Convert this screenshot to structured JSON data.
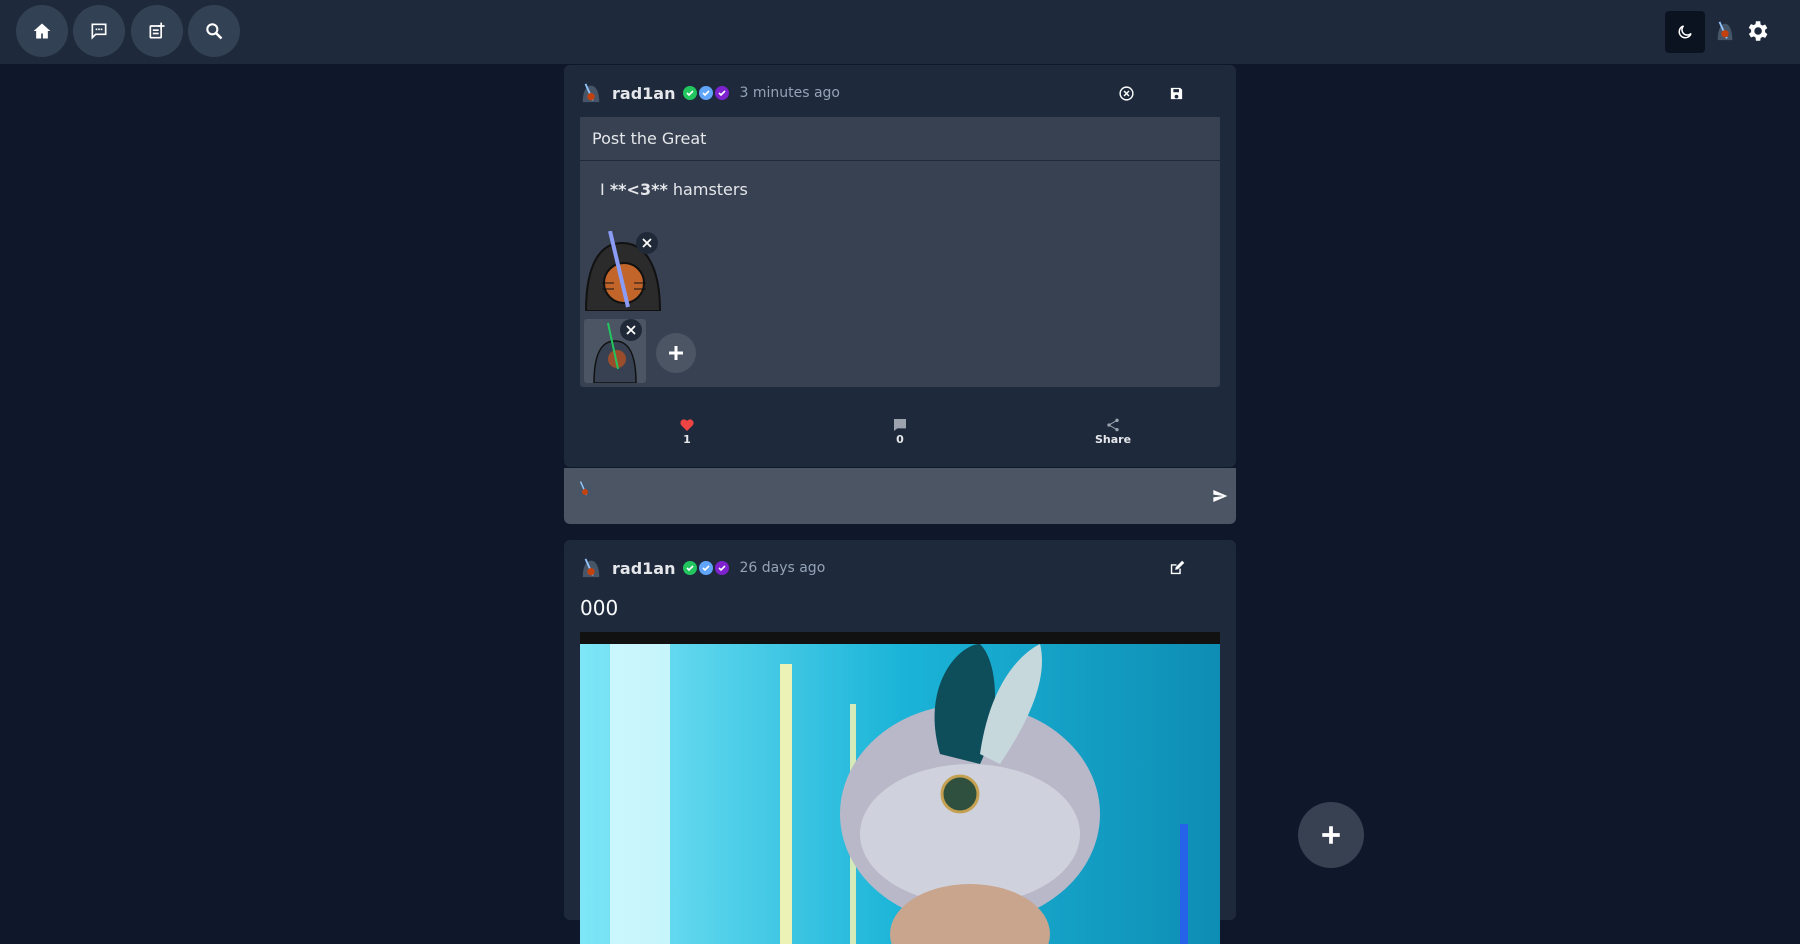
{
  "nav": {
    "home": "home-icon",
    "messages": "chat-icon",
    "new_post": "new-post-icon",
    "search": "search-icon"
  },
  "header_right": {
    "theme": "moon-icon",
    "settings": "gear-icon"
  },
  "colors": {
    "background": "#0f172a",
    "card": "#1e293b",
    "editor": "#374151",
    "heart": "#ef4444",
    "badge_green": "#22c55e",
    "badge_blue": "#60a5fa",
    "badge_purple": "#7e22ce"
  },
  "post_editing": {
    "username": "rad1an",
    "time": "3 minutes ago",
    "title_value": "Post the Great",
    "body_prefix": "I ",
    "body_bold": "**<3**",
    "body_suffix": " hamsters",
    "likes": "1",
    "comments": "0",
    "share_label": "Share"
  },
  "comment": {
    "placeholder": ""
  },
  "post2": {
    "username": "rad1an",
    "time": "26 days ago",
    "title": "000"
  }
}
